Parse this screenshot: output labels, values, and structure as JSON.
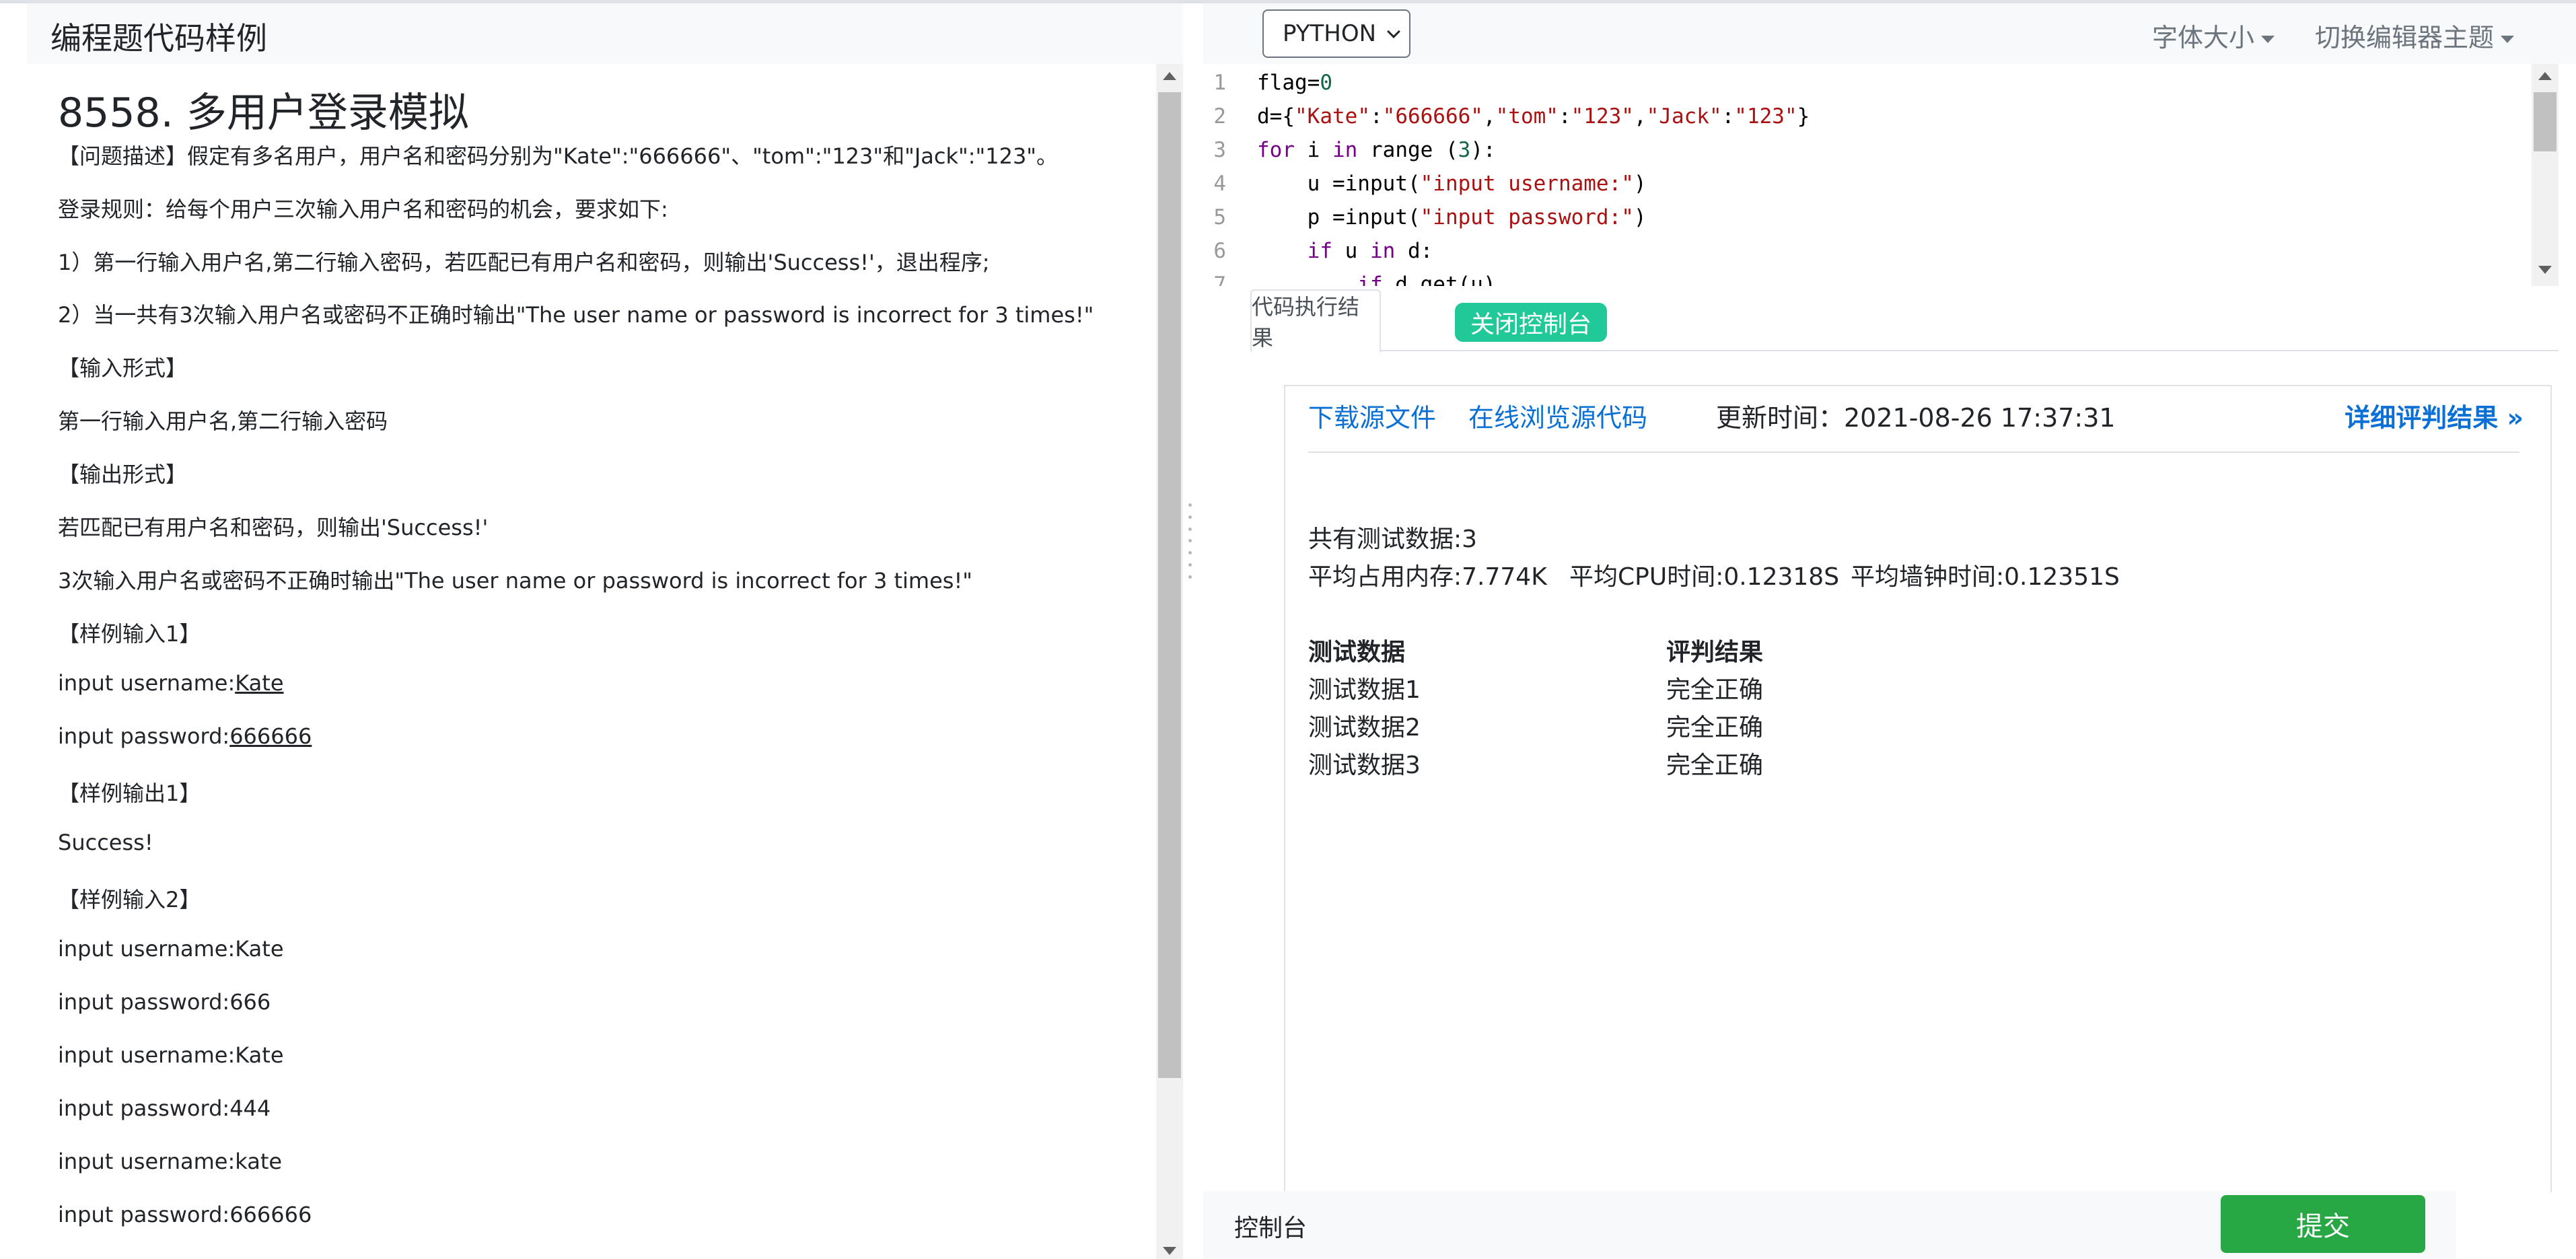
{
  "app": {
    "title": "编程题代码样例"
  },
  "problem": {
    "title": "8558. 多用户登录模拟",
    "lines": [
      "【问题描述】假定有多名用户，用户名和密码分别为\"Kate\":\"666666\"、\"tom\":\"123\"和\"Jack\":\"123\"。",
      "登录规则：给每个用户三次输入用户名和密码的机会，要求如下:",
      "1）第一行输入用户名,第二行输入密码，若匹配已有用户名和密码，则输出'Success!'，退出程序;",
      "2）当一共有3次输入用户名或密码不正确时输出\"The user name or password is incorrect for 3 times!\"",
      "【输入形式】",
      "第一行输入用户名,第二行输入密码",
      "【输出形式】",
      "若匹配已有用户名和密码，则输出'Success!'",
      "3次输入用户名或密码不正确时输出\"The user name or password is incorrect for 3 times!\"",
      "【样例输入1】"
    ],
    "sample1": {
      "username_prefix": "input username:",
      "username_value": "Kate",
      "password_prefix": "input password:",
      "password_value": "666666"
    },
    "lines2": [
      "【样例输出1】",
      "Success!",
      "【样例输入2】",
      "input username:Kate",
      "input password:666",
      "input username:Kate",
      "input password:444",
      "input username:kate",
      "input password:666666"
    ]
  },
  "toolbar": {
    "language": "PYTHON",
    "font_size_menu": "字体大小",
    "editor_theme_menu": "切换编辑器主题"
  },
  "editor": {
    "line_numbers": [
      "1",
      "2",
      "3",
      "4",
      "5",
      "6",
      "7"
    ]
  },
  "results": {
    "tab_label": "代码执行结果",
    "close_console": "关闭控制台",
    "download_source": "下载源文件",
    "browse_source": "在线浏览源代码",
    "update_time": "更新时间：2021-08-26 17:37:31",
    "detail_link": "详细评判结果 »",
    "test_count": "共有测试数据:3",
    "avg_memory": "平均占用内存:7.774K",
    "avg_cpu": "平均CPU时间:0.12318S",
    "avg_wall": "平均墙钟时间:0.12351S",
    "header_data": "测试数据",
    "header_result": "评判结果",
    "rows": [
      {
        "name": "测试数据1",
        "result": "完全正确"
      },
      {
        "name": "测试数据2",
        "result": "完全正确"
      },
      {
        "name": "测试数据3",
        "result": "完全正确"
      }
    ]
  },
  "bottom": {
    "console_label": "控制台",
    "submit_label": "提交"
  },
  "colors": {
    "link": "#0b70d6",
    "submit": "#28a745",
    "close_console": "#20c997"
  }
}
